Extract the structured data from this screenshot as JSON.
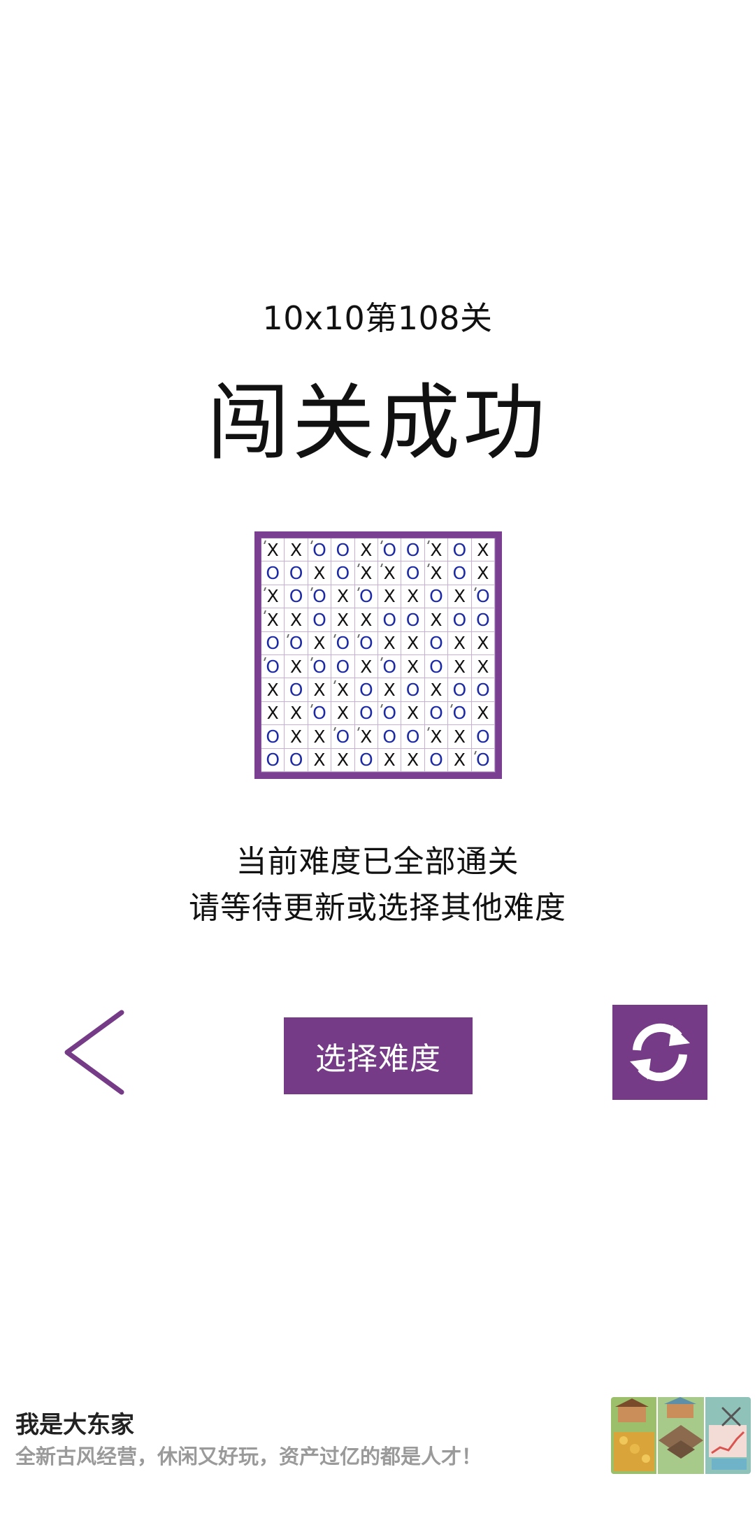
{
  "level": {
    "title": "10x10第108关"
  },
  "result": {
    "title": "闯关成功"
  },
  "board": {
    "rows": [
      [
        "X",
        "X",
        "O",
        "O",
        "X",
        "O",
        "O",
        "X",
        "O",
        "X"
      ],
      [
        "O",
        "O",
        "X",
        "O",
        "X",
        "X",
        "O",
        "X",
        "O",
        "X"
      ],
      [
        "X",
        "O",
        "O",
        "X",
        "O",
        "X",
        "X",
        "O",
        "X",
        "O"
      ],
      [
        "X",
        "X",
        "O",
        "X",
        "X",
        "O",
        "O",
        "X",
        "O",
        "O"
      ],
      [
        "O",
        "O",
        "X",
        "O",
        "O",
        "X",
        "X",
        "O",
        "X",
        "X"
      ],
      [
        "O",
        "X",
        "O",
        "O",
        "X",
        "O",
        "X",
        "O",
        "X",
        "X"
      ],
      [
        "X",
        "O",
        "X",
        "X",
        "O",
        "X",
        "O",
        "X",
        "O",
        "O"
      ],
      [
        "X",
        "X",
        "O",
        "X",
        "O",
        "O",
        "X",
        "O",
        "O",
        "X"
      ],
      [
        "O",
        "X",
        "X",
        "O",
        "X",
        "O",
        "O",
        "X",
        "X",
        "O"
      ],
      [
        "O",
        "O",
        "X",
        "X",
        "O",
        "X",
        "X",
        "O",
        "X",
        "O"
      ]
    ],
    "given_marks": [
      [
        0,
        0
      ],
      [
        0,
        2
      ],
      [
        0,
        5
      ],
      [
        0,
        7
      ],
      [
        1,
        4
      ],
      [
        1,
        5
      ],
      [
        1,
        7
      ],
      [
        2,
        0
      ],
      [
        2,
        2
      ],
      [
        2,
        4
      ],
      [
        2,
        9
      ],
      [
        3,
        0
      ],
      [
        4,
        1
      ],
      [
        4,
        3
      ],
      [
        4,
        4
      ],
      [
        5,
        0
      ],
      [
        5,
        2
      ],
      [
        5,
        5
      ],
      [
        6,
        3
      ],
      [
        7,
        2
      ],
      [
        7,
        5
      ],
      [
        7,
        8
      ],
      [
        8,
        3
      ],
      [
        8,
        4
      ],
      [
        8,
        7
      ],
      [
        9,
        9
      ]
    ],
    "colors": {
      "frame": "#7b3f92",
      "x_mark": "#111111",
      "o_mark": "#1d2aa6"
    }
  },
  "message": {
    "line1": "当前难度已全部通关",
    "line2": "请等待更新或选择其他难度"
  },
  "controls": {
    "back_icon": "chevron-left-icon",
    "difficulty_label": "选择难度",
    "refresh_icon": "refresh-icon",
    "accent_color": "#753b86"
  },
  "ad": {
    "title": "我是大东家",
    "description": "全新古风经营，休闲又好玩，资产过亿的都是人才！",
    "close_icon": "close-icon"
  }
}
